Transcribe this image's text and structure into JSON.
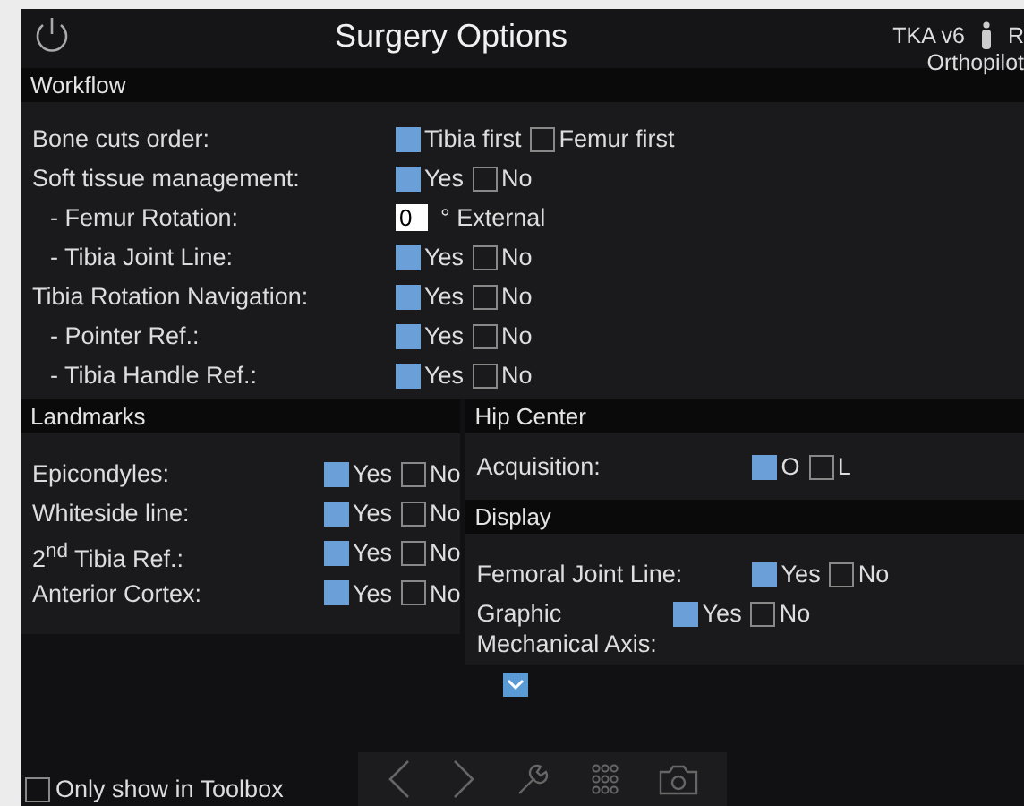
{
  "header": {
    "title": "Surgery Options",
    "version": "TKA v6",
    "side": "R",
    "product": "Orthopilot"
  },
  "workflow": {
    "title": "Workflow",
    "rows": [
      {
        "label": "Bone cuts order:",
        "kind": "choice",
        "options": [
          {
            "label": "Tibia first",
            "checked": true
          },
          {
            "label": "Femur first",
            "checked": false
          }
        ]
      },
      {
        "label": "Soft tissue management:",
        "kind": "choice",
        "options": [
          {
            "label": "Yes",
            "checked": true
          },
          {
            "label": "No",
            "checked": false
          }
        ],
        "children": [
          {
            "label": "- Femur Rotation:",
            "kind": "number",
            "value": "0",
            "unit": "° External"
          },
          {
            "label": "- Tibia Joint Line:",
            "kind": "choice",
            "options": [
              {
                "label": "Yes",
                "checked": true
              },
              {
                "label": "No",
                "checked": false
              }
            ]
          }
        ]
      },
      {
        "label": "Tibia Rotation Navigation:",
        "kind": "choice",
        "options": [
          {
            "label": "Yes",
            "checked": true
          },
          {
            "label": "No",
            "checked": false
          }
        ],
        "children": [
          {
            "label": "- Pointer Ref.:",
            "kind": "choice",
            "options": [
              {
                "label": "Yes",
                "checked": true
              },
              {
                "label": "No",
                "checked": false
              }
            ]
          },
          {
            "label": "- Tibia Handle Ref.:",
            "kind": "choice",
            "options": [
              {
                "label": "Yes",
                "checked": true
              },
              {
                "label": "No",
                "checked": false
              }
            ]
          }
        ]
      }
    ]
  },
  "landmarks": {
    "title": "Landmarks",
    "rows": [
      {
        "label": "Epicondyles:",
        "kind": "choice",
        "options": [
          {
            "label": "Yes",
            "checked": true
          },
          {
            "label": "No",
            "checked": false
          }
        ]
      },
      {
        "label": "Whiteside line:",
        "kind": "choice",
        "options": [
          {
            "label": "Yes",
            "checked": true
          },
          {
            "label": "No",
            "checked": false
          }
        ]
      },
      {
        "label": "2$^{nd}$ Tibia Ref.:",
        "kind": "choice",
        "options": [
          {
            "label": "Yes",
            "checked": true
          },
          {
            "label": "No",
            "checked": false
          }
        ]
      },
      {
        "label": "Anterior Cortex:",
        "kind": "choice",
        "options": [
          {
            "label": "Yes",
            "checked": true
          },
          {
            "label": "No",
            "checked": false
          }
        ]
      }
    ]
  },
  "hip_center": {
    "title": "Hip Center",
    "rows": [
      {
        "label": "Acquisition:",
        "kind": "choice",
        "options": [
          {
            "label": "O",
            "checked": true
          },
          {
            "label": "L",
            "checked": false
          }
        ]
      }
    ]
  },
  "display": {
    "title": "Display",
    "rows": [
      {
        "label": "Femoral Joint Line:",
        "kind": "choice",
        "options": [
          {
            "label": "Yes",
            "checked": true
          },
          {
            "label": "No",
            "checked": false
          }
        ]
      },
      {
        "label": "Graphic Mechanical Axis:",
        "kind": "choice",
        "options": [
          {
            "label": "Yes",
            "checked": true
          },
          {
            "label": "No",
            "checked": false
          }
        ]
      }
    ]
  },
  "footer": {
    "toolbox_only": {
      "label": "Only show in Toolbox",
      "checked": false
    }
  }
}
